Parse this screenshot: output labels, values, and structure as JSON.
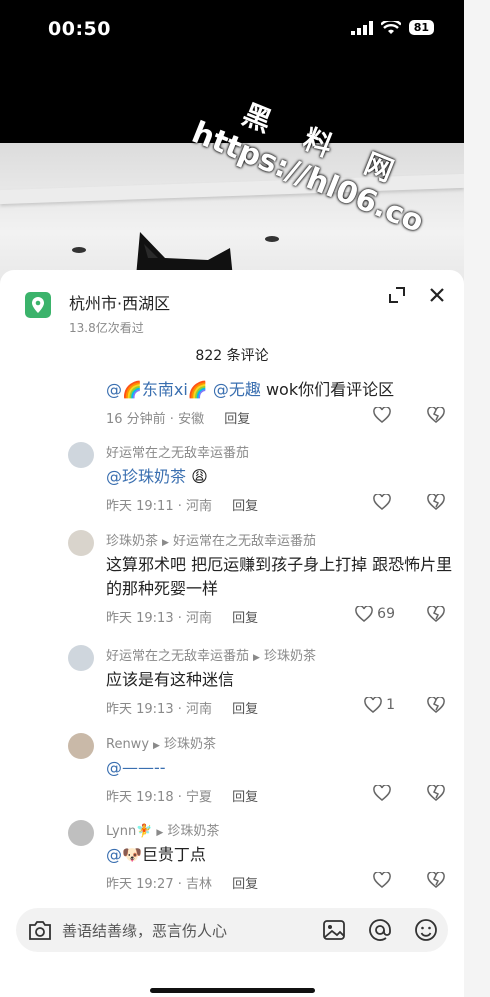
{
  "status": {
    "time": "00:50",
    "battery": "81"
  },
  "watermark": {
    "line1": "黑 料 网",
    "line2": "https://hl06.co"
  },
  "location": {
    "title": "杭州市·西湖区",
    "views": "13.8亿次看过"
  },
  "comments_count": "822 条评论",
  "comments": [
    {
      "author": "",
      "reply_to": "",
      "mention": "@🌈东南xi🌈 @无趣",
      "text": " wok你们看评论区",
      "time": "16 分钟前 · 安徽",
      "reply": "回复",
      "likes": ""
    },
    {
      "author": "好运常在之无敌幸运番茄",
      "reply_to": "",
      "mention": "@珍珠奶茶",
      "text": " 😩",
      "time": "昨天 19:11 · 河南",
      "reply": "回复",
      "likes": ""
    },
    {
      "author": "珍珠奶茶",
      "reply_to": "好运常在之无敌幸运番茄",
      "mention": "",
      "text": "这算邪术吧 把厄运赚到孩子身上打掉 跟恐怖片里的那种死婴一样",
      "time": "昨天 19:13 · 河南",
      "reply": "回复",
      "likes": "69"
    },
    {
      "author": "好运常在之无敌幸运番茄",
      "reply_to": "珍珠奶茶",
      "mention": "",
      "text": "应该是有这种迷信",
      "time": "昨天 19:13 · 河南",
      "reply": "回复",
      "likes": "1"
    },
    {
      "author": "Renwy",
      "reply_to": "珍珠奶茶",
      "mention": "@——--",
      "text": "",
      "time": "昨天 19:18 · 宁夏",
      "reply": "回复",
      "likes": ""
    },
    {
      "author": "Lynn🧚",
      "reply_to": "珍珠奶茶",
      "mention": "@🐶",
      "text": "巨贵丁点",
      "time": "昨天 19:27 · 吉林",
      "reply": "回复",
      "likes": ""
    }
  ],
  "input": {
    "placeholder": "善语结善缘，恶言伤人心"
  },
  "colors": {
    "accent": "#3bb36b",
    "mention": "#3a6fb0"
  }
}
